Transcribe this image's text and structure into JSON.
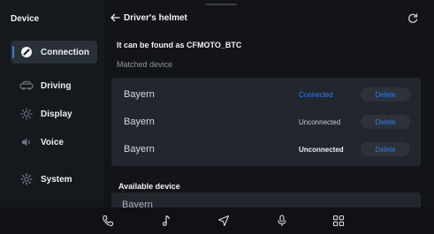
{
  "sidebar": {
    "title": "Device",
    "items": [
      {
        "label": "Connection",
        "icon": "link-icon"
      },
      {
        "label": "Driving",
        "icon": "car-icon"
      },
      {
        "label": "Display",
        "icon": "sun-icon"
      },
      {
        "label": "Voice",
        "icon": "speaker-icon"
      },
      {
        "label": "System",
        "icon": "gear-icon"
      }
    ]
  },
  "header": {
    "title": "Driver's helmet"
  },
  "info": {
    "found_as": "It can be found as CFMOTO_BTC"
  },
  "matched": {
    "label": "Matched device",
    "rows": [
      {
        "name": "Bayern",
        "status": "Connected",
        "delete": "Delete"
      },
      {
        "name": "Bayern",
        "status": "Unconnected",
        "delete": "Delete"
      },
      {
        "name": "Bayern",
        "status": "Unconnected",
        "delete": "Delete"
      }
    ]
  },
  "available": {
    "label": "Available device",
    "rows": [
      {
        "name": "Bayern"
      }
    ]
  },
  "dock": {
    "icons": [
      "phone-icon",
      "music-icon",
      "navigation-icon",
      "mic-icon",
      "apps-grid-icon"
    ]
  },
  "colors": {
    "accent": "#2f7cf6",
    "connected": "#2f7cf6",
    "unconnected": "#c7ccd2"
  }
}
